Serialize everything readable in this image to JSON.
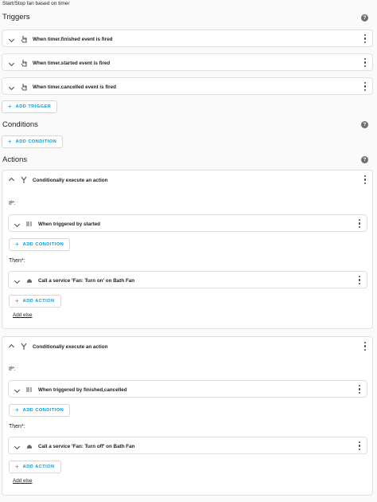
{
  "page_title": "Start/Stop fan based on timer",
  "triggers": {
    "title": "Triggers",
    "items": [
      {
        "label": "When timer.finished event is fired",
        "icon": "hand-icon"
      },
      {
        "label": "When timer.started event is fired",
        "icon": "hand-icon"
      },
      {
        "label": "When timer.cancelled event is fired",
        "icon": "hand-icon"
      }
    ],
    "add_label": "ADD TRIGGER"
  },
  "conditions": {
    "title": "Conditions",
    "add_label": "ADD CONDITION"
  },
  "actions": {
    "title": "Actions",
    "blocks": [
      {
        "label": "Conditionally execute an action",
        "if_label": "If*:",
        "condition": "When triggered by started",
        "add_condition_label": "ADD CONDITION",
        "then_label": "Then*:",
        "action": "Call a service 'Fan: Turn on' on Bath Fan",
        "add_action_label": "ADD ACTION",
        "add_else_label": "Add else"
      },
      {
        "label": "Conditionally execute an action",
        "if_label": "If*:",
        "condition": "When triggered by finished,cancelled",
        "add_condition_label": "ADD CONDITION",
        "then_label": "Then*:",
        "action": "Call a service 'Fan: Turn off' on Bath Fan",
        "add_action_label": "ADD ACTION",
        "add_else_label": "Add else"
      }
    ]
  },
  "colors": {
    "accent": "#039be5",
    "icon": "#444444",
    "help": "#6f6f6f"
  }
}
